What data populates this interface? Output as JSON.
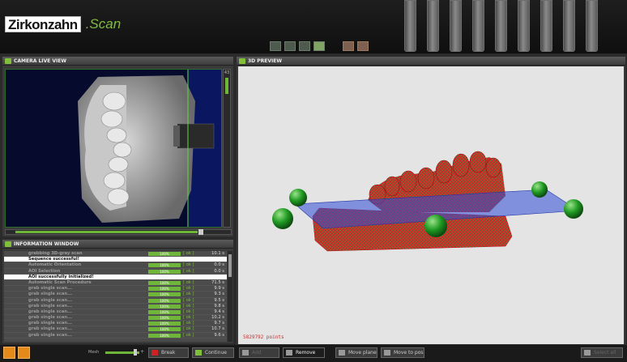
{
  "app": {
    "logo_zirkon": "Zirkon",
    "logo_zahn": "zahn",
    "logo_scan": ".Scan"
  },
  "camera_panel": {
    "title": "CAMERA LIVE VIEW",
    "slider_top_label": "43"
  },
  "info_panel": {
    "title": "INFORMATION WINDOW",
    "rows": [
      {
        "name": "grabbing 3D-gray scan",
        "progress": "100%",
        "ok": "[ ok ]",
        "time": "10.1 s",
        "kind": "dim"
      },
      {
        "name": "Sequence successful!",
        "kind": "msg"
      },
      {
        "name": "Automatic Orientation",
        "progress": "100%",
        "ok": "[ ok ]",
        "time": "0.0 s",
        "kind": "dim"
      },
      {
        "name": "AOI Selection",
        "progress": "100%",
        "ok": "[ ok ]",
        "time": "0.0 s",
        "kind": "dim"
      },
      {
        "name": "AOI successfully initialized!",
        "kind": "msg"
      },
      {
        "name": "Automatic Scan Procedure",
        "progress": "100%",
        "ok": "[ ok ]",
        "time": "71.5 s",
        "kind": "dim"
      },
      {
        "name": "grab single scan...",
        "progress": "100%",
        "ok": "[ ok ]",
        "time": "9.9 s",
        "kind": "dim"
      },
      {
        "name": "grab single scan...",
        "progress": "100%",
        "ok": "[ ok ]",
        "time": "9.3 s",
        "kind": "dim"
      },
      {
        "name": "grab single scan...",
        "progress": "100%",
        "ok": "[ ok ]",
        "time": "9.5 s",
        "kind": "dim"
      },
      {
        "name": "grab single scan...",
        "progress": "100%",
        "ok": "[ ok ]",
        "time": "9.8 s",
        "kind": "dim"
      },
      {
        "name": "grab single scan...",
        "progress": "100%",
        "ok": "[ ok ]",
        "time": "9.4 s",
        "kind": "dim"
      },
      {
        "name": "grab single scan...",
        "progress": "100%",
        "ok": "[ ok ]",
        "time": "10.2 s",
        "kind": "dim"
      },
      {
        "name": "grab single scan...",
        "progress": "100%",
        "ok": "[ ok ]",
        "time": "9.7 s",
        "kind": "dim"
      },
      {
        "name": "grab single scan...",
        "progress": "100%",
        "ok": "[ ok ]",
        "time": "10.7 s",
        "kind": "dim"
      },
      {
        "name": "grab single scan...",
        "progress": "100%",
        "ok": "[ ok ]",
        "time": "9.6 s",
        "kind": "dim"
      }
    ]
  },
  "preview_panel": {
    "title": "3D PREVIEW",
    "points_label": "5829792 points"
  },
  "bottombar": {
    "mesh_label": "Mesh",
    "mesh_plus": "+",
    "break_label": "Break",
    "continue_label": "Continue",
    "add_label": "Add",
    "remove_label": "Remove",
    "move_plane_label": "Move plane",
    "move_to_pos_label": "Move to pos",
    "select_all_label": "Select all"
  },
  "colors": {
    "accent_green": "#7fbf3a",
    "model_red": "#d9262c",
    "plane_blue": "#3355cc"
  }
}
